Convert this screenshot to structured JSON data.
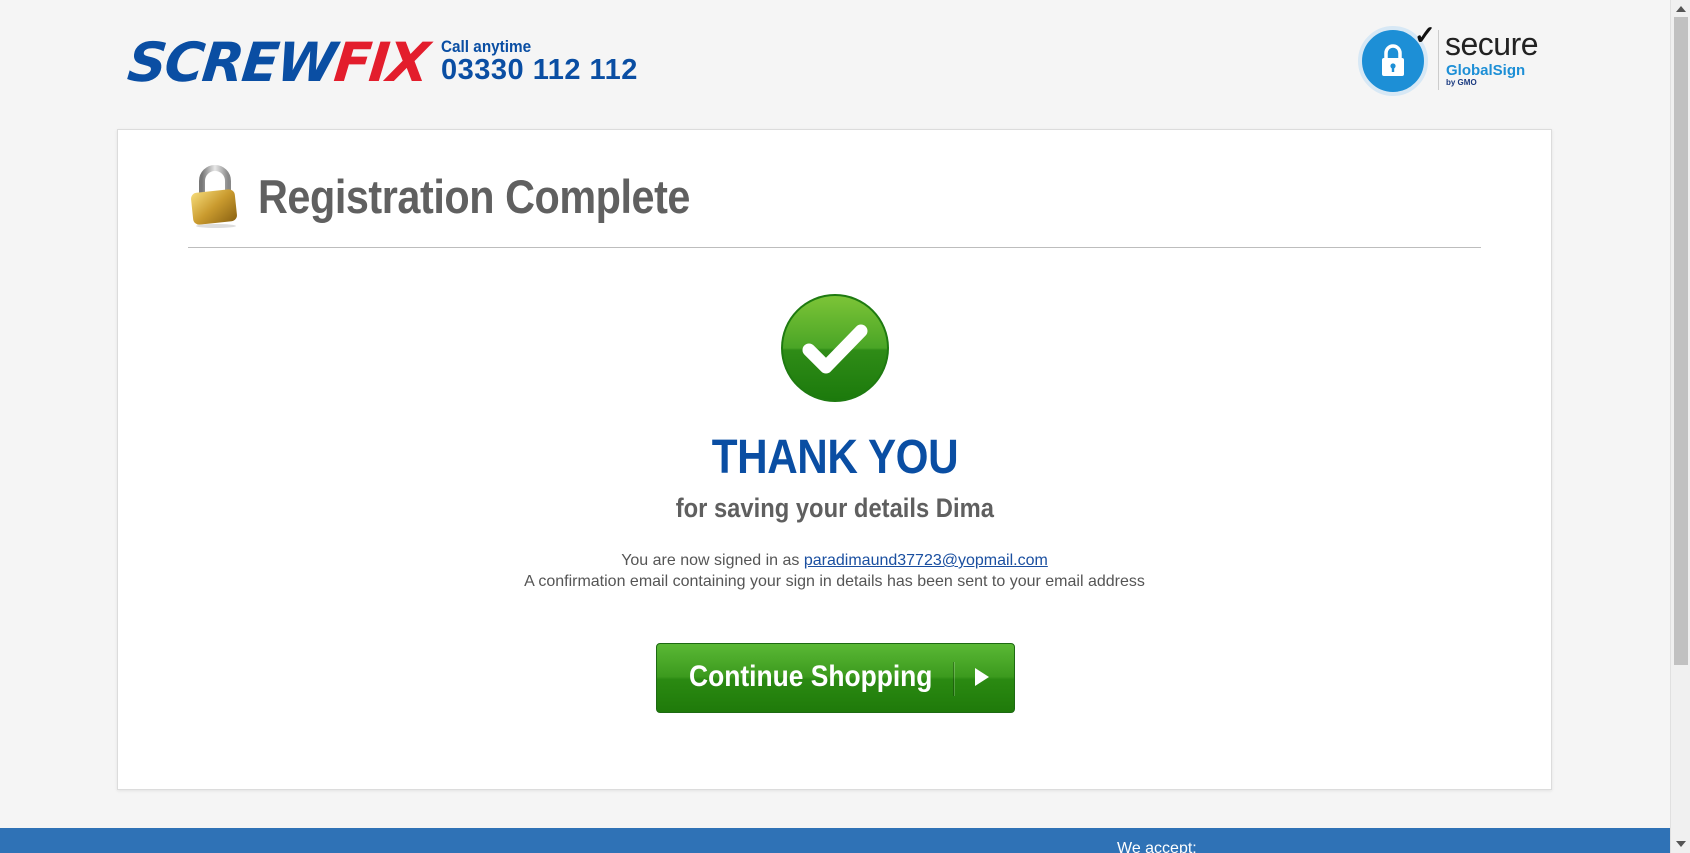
{
  "header": {
    "logo": {
      "part1": "SCREW",
      "part2": "FIX"
    },
    "call_label": "Call anytime",
    "phone": "03330 112 112",
    "secure_badge": {
      "word": "secure",
      "provider": "GlobalSign",
      "by": "by GMO"
    }
  },
  "card": {
    "title": "Registration Complete",
    "thanks": "THANK YOU",
    "subtitle": "for saving your details Dima",
    "signed_in_prefix": "You are now signed in as",
    "email": "paradimaund37723@yopmail.com",
    "confirmation": "A confirmation email containing your sign in details has been sent to your email address",
    "continue_label": "Continue Shopping"
  },
  "footer": {
    "we_accept": "We accept:"
  },
  "colors": {
    "brand_blue": "#0a4ea3",
    "brand_red": "#e31d2c",
    "button_green": "#3c9a1e",
    "footer_blue": "#2f72b6"
  },
  "icons": [
    "padlock-icon",
    "check-circle-icon",
    "secure-lock-icon",
    "play-arrow-icon"
  ]
}
